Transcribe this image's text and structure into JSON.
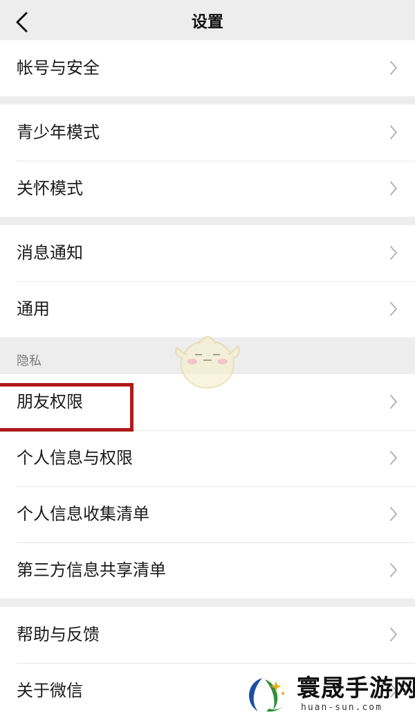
{
  "nav": {
    "title": "设置",
    "back_icon": "chevron-left-icon"
  },
  "groups": [
    {
      "items": [
        {
          "label": "帐号与安全"
        }
      ]
    },
    {
      "items": [
        {
          "label": "青少年模式"
        },
        {
          "label": "关怀模式"
        }
      ]
    },
    {
      "items": [
        {
          "label": "消息通知"
        },
        {
          "label": "通用"
        }
      ]
    },
    {
      "header": "隐私",
      "items": [
        {
          "label": "朋友权限",
          "highlighted": true
        },
        {
          "label": "个人信息与权限"
        },
        {
          "label": "个人信息收集清单"
        },
        {
          "label": "第三方信息共享清单"
        }
      ]
    },
    {
      "items": [
        {
          "label": "帮助与反馈"
        },
        {
          "label": "关于微信"
        }
      ]
    }
  ],
  "row_icon": "chevron-right-icon",
  "highlight_color": "#b01a17",
  "watermark": {
    "name": "寰晟手游网",
    "url": "huan-sun.com"
  }
}
